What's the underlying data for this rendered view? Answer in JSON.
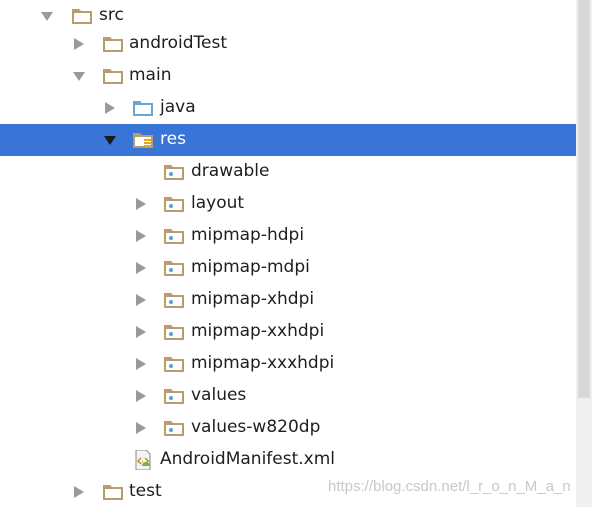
{
  "project_tree": {
    "colors": {
      "selection": "#3875d7",
      "folder": "#b89c6c",
      "source_folder": "#6aa6d0",
      "arrow": "#9a9a9a"
    },
    "nodes": [
      {
        "label": "src",
        "state": "expanded",
        "icon": "folder-icon"
      },
      {
        "label": "androidTest",
        "state": "collapsed",
        "icon": "folder-icon"
      },
      {
        "label": "main",
        "state": "expanded",
        "icon": "folder-icon"
      },
      {
        "label": "java",
        "state": "collapsed",
        "icon": "source-folder-icon"
      },
      {
        "label": "res",
        "state": "expanded",
        "icon": "resource-folder-icon",
        "selected": true
      },
      {
        "label": "drawable",
        "state": "leaf",
        "icon": "resource-dir-icon"
      },
      {
        "label": "layout",
        "state": "collapsed",
        "icon": "resource-dir-icon"
      },
      {
        "label": "mipmap-hdpi",
        "state": "collapsed",
        "icon": "resource-dir-icon"
      },
      {
        "label": "mipmap-mdpi",
        "state": "collapsed",
        "icon": "resource-dir-icon"
      },
      {
        "label": "mipmap-xhdpi",
        "state": "collapsed",
        "icon": "resource-dir-icon"
      },
      {
        "label": "mipmap-xxhdpi",
        "state": "collapsed",
        "icon": "resource-dir-icon"
      },
      {
        "label": "mipmap-xxxhdpi",
        "state": "collapsed",
        "icon": "resource-dir-icon"
      },
      {
        "label": "values",
        "state": "collapsed",
        "icon": "resource-dir-icon"
      },
      {
        "label": "values-w820dp",
        "state": "collapsed",
        "icon": "resource-dir-icon"
      },
      {
        "label": "AndroidManifest.xml",
        "state": "leaf",
        "icon": "manifest-file-icon"
      },
      {
        "label": "test",
        "state": "collapsed",
        "icon": "folder-icon"
      }
    ]
  },
  "watermark": {
    "text": "https://blog.csdn.net/l_r_o_n_M_a_n"
  }
}
